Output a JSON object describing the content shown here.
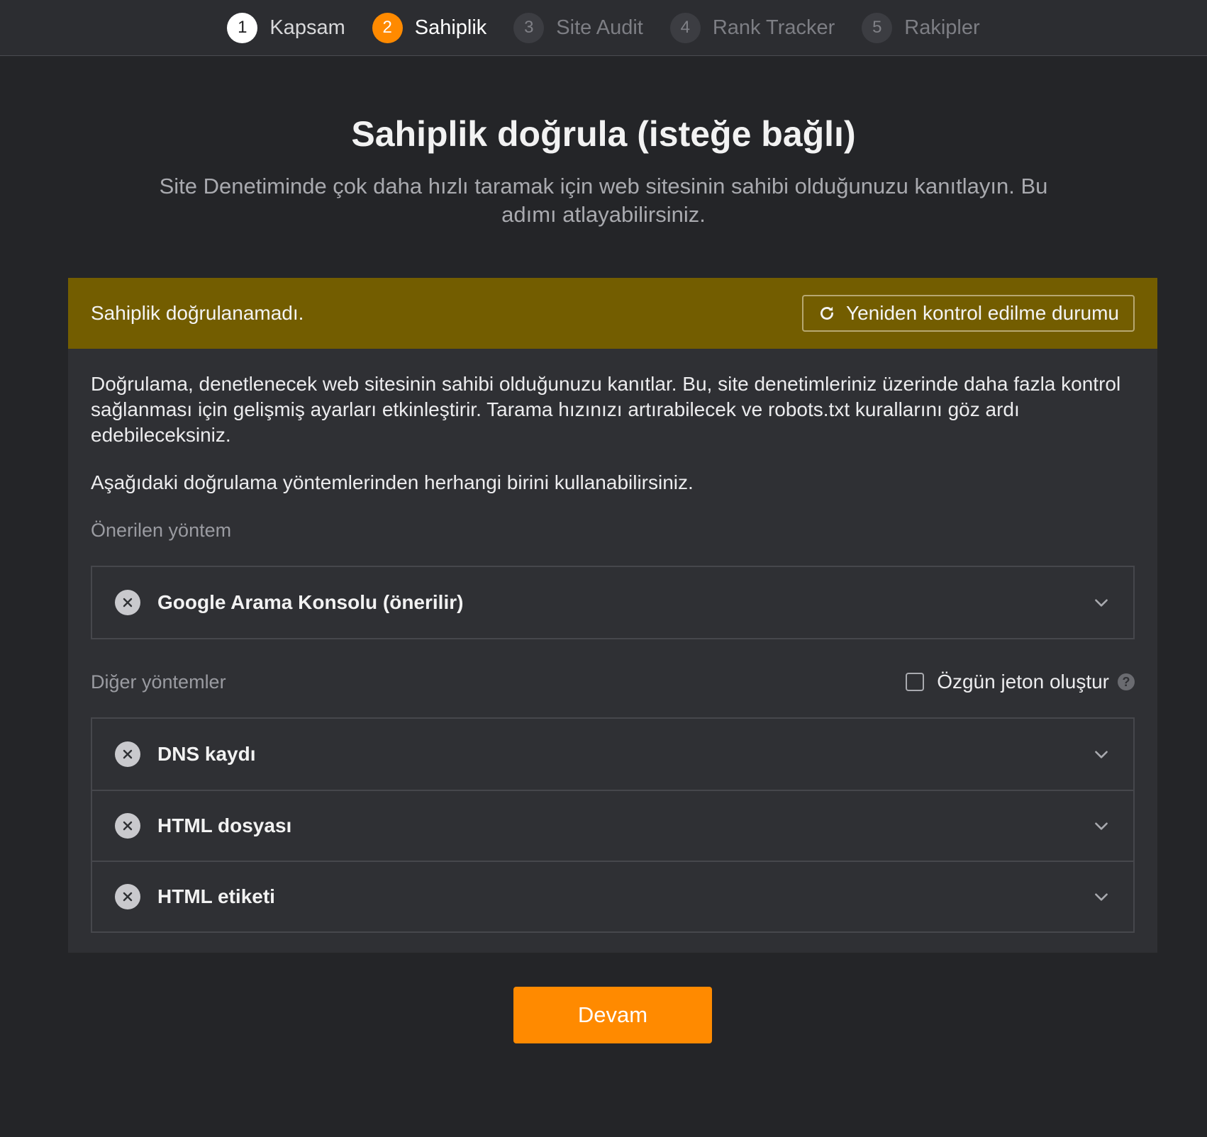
{
  "stepper": {
    "steps": [
      {
        "num": "1",
        "label": "Kapsam"
      },
      {
        "num": "2",
        "label": "Sahiplik"
      },
      {
        "num": "3",
        "label": "Site Audit"
      },
      {
        "num": "4",
        "label": "Rank Tracker"
      },
      {
        "num": "5",
        "label": "Rakipler"
      }
    ]
  },
  "header": {
    "title": "Sahiplik doğrula (isteğe bağlı)",
    "subtitle": "Site Denetiminde çok daha hızlı taramak için web sitesinin sahibi olduğunuzu kanıtlayın. Bu adımı atlayabilirsiniz."
  },
  "alert": {
    "text": "Sahiplik doğrulanamadı.",
    "recheck_label": "Yeniden kontrol edilme durumu",
    "color": "#735d00"
  },
  "body": {
    "description": "Doğrulama, denetlenecek web sitesinin sahibi olduğunuzu kanıtlar. Bu, site denetimleriniz üzerinde daha fazla kontrol sağlanması için gelişmiş ayarları etkinleştirir. Tarama hızınızı artırabilecek ve robots.txt kurallarını göz ardı edebileceksiniz.",
    "instruction": "Aşağıdaki doğrulama yöntemlerinden herhangi birini kullanabilirsiniz.",
    "recommended_label": "Önerilen yöntem",
    "recommended_methods": [
      {
        "label": "Google Arama Konsolu (önerilir)",
        "status_icon": "x-circle-icon"
      }
    ],
    "other_label": "Diğer yöntemler",
    "token_label": "Özgün jeton oluştur",
    "token_checked": false,
    "other_methods": [
      {
        "label": "DNS kaydı",
        "status_icon": "x-circle-icon"
      },
      {
        "label": "HTML dosyası",
        "status_icon": "x-circle-icon"
      },
      {
        "label": "HTML etiketi",
        "status_icon": "x-circle-icon"
      }
    ]
  },
  "footer": {
    "continue_label": "Devam",
    "accent": "#ff8a00"
  }
}
